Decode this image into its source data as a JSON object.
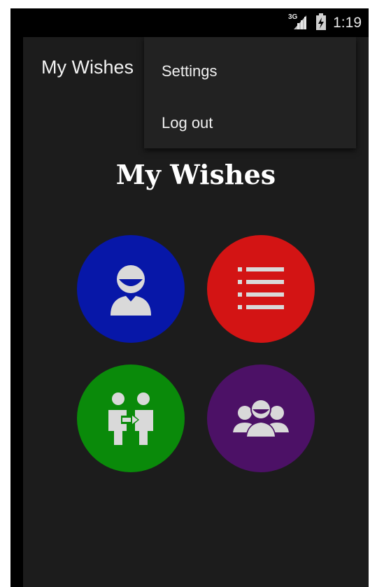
{
  "status_bar": {
    "network_label": "3G",
    "time": "1:19",
    "icons": [
      "signal-icon",
      "battery-charging-icon"
    ]
  },
  "action_bar": {
    "title": "My Wishes"
  },
  "overflow_menu": {
    "items": [
      {
        "label": "Settings"
      },
      {
        "label": "Log out"
      }
    ]
  },
  "main": {
    "heading": "My Wishes",
    "tiles": [
      {
        "icon": "profile-icon",
        "color": "#0717a8"
      },
      {
        "icon": "list-icon",
        "color": "#d31414"
      },
      {
        "icon": "share-with-person-icon",
        "color": "#0a8a0a"
      },
      {
        "icon": "friends-group-icon",
        "color": "#4c1166"
      }
    ]
  },
  "colors": {
    "screen_background": "#1c1c1c",
    "menu_background": "#222222",
    "icon_gray": "#d9d9d9"
  }
}
